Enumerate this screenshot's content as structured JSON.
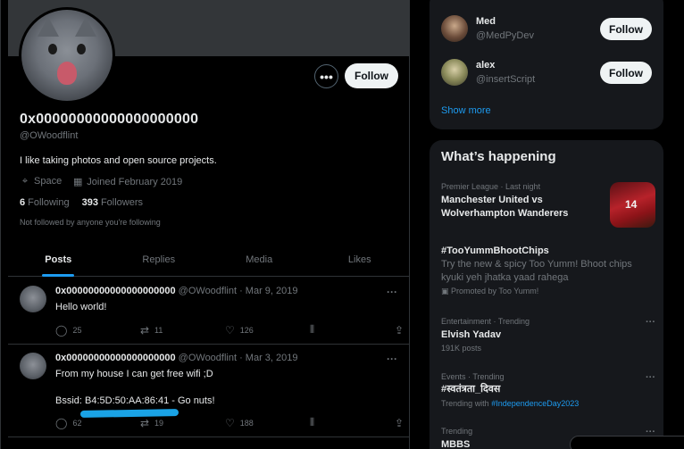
{
  "profile": {
    "display_name": "0x00000000000000000000",
    "handle": "@OWoodflint",
    "bio": "I like taking photos and open source projects.",
    "location": "Space",
    "joined": "Joined February 2019",
    "following_count": "6",
    "following_label": "Following",
    "followers_count": "393",
    "followers_label": "Followers",
    "not_followed": "Not followed by anyone you're following",
    "more_glyph": "•••",
    "follow_label": "Follow"
  },
  "tabs": [
    {
      "label": "Posts"
    },
    {
      "label": "Replies"
    },
    {
      "label": "Media"
    },
    {
      "label": "Likes"
    }
  ],
  "tweets": [
    {
      "name": "0x00000000000000000000",
      "handle_date": "@OWoodflint · Mar 9, 2019",
      "text1": "Hello world!",
      "text2": "",
      "replies": "25",
      "retweets": "11",
      "likes": "126"
    },
    {
      "name": "0x00000000000000000000",
      "handle_date": "@OWoodflint · Mar 3, 2019",
      "text1": "From my house I can get free wifi ;D",
      "text2": "Bssid: B4:5D:50:AA:86:41 - Go nuts!",
      "replies": "62",
      "retweets": "19",
      "likes": "188"
    }
  ],
  "who_to_follow": [
    {
      "name": "Med",
      "handle": "@MedPyDev",
      "follow": "Follow"
    },
    {
      "name": "alex",
      "handle": "@insertScript",
      "follow": "Follow"
    }
  ],
  "show_more": "Show more",
  "happening": {
    "title": "What’s happening",
    "trends": [
      {
        "context": "Premier League · Last night",
        "title": "Manchester United vs Wolverhampton Wanderers",
        "image_number": "14"
      },
      {
        "title": "#TooYummBhootChips",
        "description": "Try the new & spicy Too Yumm! Bhoot chips kyuki yeh jhatka yaad rahega",
        "promoted": "Promoted by Too Yumm!"
      },
      {
        "context": "Entertainment · Trending",
        "title": "Elvish Yadav",
        "sub": "191K posts"
      },
      {
        "context": "Events · Trending",
        "title": "#स्वतंत्रता_दिवस",
        "sub_prefix": "Trending with",
        "sub_link": "#IndependenceDay2023"
      },
      {
        "context": "Trending",
        "title": "MBBS"
      }
    ]
  },
  "colors": {
    "accent": "#1d9bf0",
    "background": "#000000",
    "card": "#16181c"
  }
}
